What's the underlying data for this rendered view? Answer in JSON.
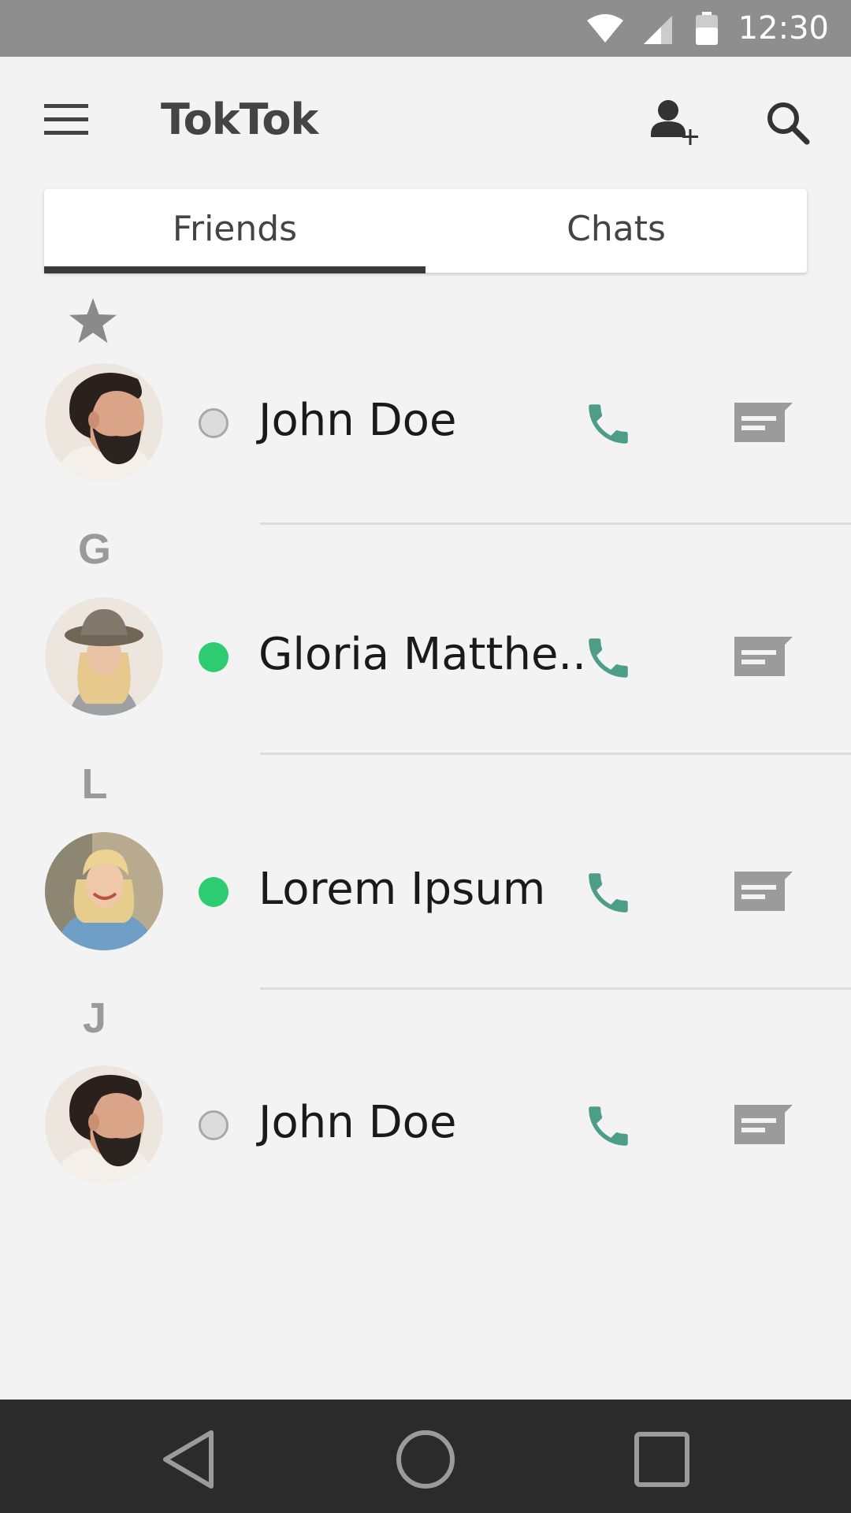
{
  "status_bar": {
    "time": "12:30",
    "icons": [
      "wifi-icon",
      "signal-icon",
      "battery-icon"
    ]
  },
  "app_bar": {
    "title": "TokTok",
    "icons": [
      "menu-icon",
      "add-user-icon",
      "search-icon"
    ]
  },
  "tabs": [
    {
      "label": "Friends",
      "active": true
    },
    {
      "label": "Chats",
      "active": false
    }
  ],
  "sections": [
    {
      "header": "",
      "header_icon": "star-icon"
    },
    {
      "header": "G"
    },
    {
      "header": "L"
    },
    {
      "header": "J"
    }
  ],
  "contacts": [
    {
      "name": "John Doe",
      "status": "offline",
      "avatar": "man-with-beard"
    },
    {
      "name": "Gloria Matthe..",
      "status": "online",
      "avatar": "woman-in-hat"
    },
    {
      "name": "Lorem Ipsum",
      "status": "online",
      "avatar": "woman-with-scarf"
    },
    {
      "name": "John Doe",
      "status": "offline",
      "avatar": "man-with-beard"
    }
  ],
  "colors": {
    "online": "#2ecc71",
    "offline": "#dcdcdc",
    "call_icon": "#4e9e86",
    "message_icon": "#9b9b9b",
    "nav_bar": "#2b2b2b",
    "status_bar": "#8e8e8e"
  },
  "nav_bar": {
    "icons": [
      "back-icon",
      "home-icon",
      "recents-icon"
    ]
  }
}
